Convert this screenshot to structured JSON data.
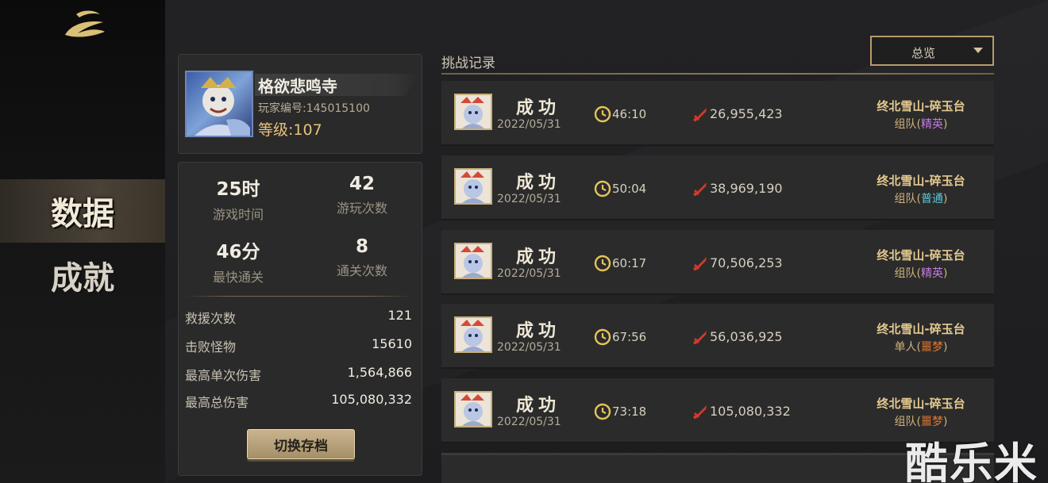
{
  "nav": {
    "data_label": "数据",
    "achievement_label": "成就"
  },
  "profile": {
    "name": "格欲悲鸣寺",
    "player_id": "玩家编号:145015100",
    "level": "等级:107"
  },
  "stats": {
    "play_time_value": "25时",
    "play_time_label": "游戏时间",
    "play_count_value": "42",
    "play_count_label": "游玩次数",
    "fastest_value": "46分",
    "fastest_label": "最快通关",
    "clear_count_value": "8",
    "clear_count_label": "通关次数",
    "rows": [
      {
        "label": "救援次数",
        "value": "121"
      },
      {
        "label": "击败怪物",
        "value": "15610"
      },
      {
        "label": "最高单次伤害",
        "value": "1,564,866"
      },
      {
        "label": "最高总伤害",
        "value": "105,080,332"
      }
    ],
    "switch_save_label": "切换存档"
  },
  "records_header": {
    "title": "挑战记录",
    "filter_value": "总览"
  },
  "records": [
    {
      "result": "成功",
      "date": "2022/05/31",
      "time": "46:10",
      "damage": "26,955,423",
      "stage": "终北雪山-碎玉台",
      "mode_prefix": "组队(",
      "difficulty": "精英",
      "mode_suffix": ")"
    },
    {
      "result": "成功",
      "date": "2022/05/31",
      "time": "50:04",
      "damage": "38,969,190",
      "stage": "终北雪山-碎玉台",
      "mode_prefix": "组队(",
      "difficulty": "普通",
      "mode_suffix": ")"
    },
    {
      "result": "成功",
      "date": "2022/05/31",
      "time": "60:17",
      "damage": "70,506,253",
      "stage": "终北雪山-碎玉台",
      "mode_prefix": "组队(",
      "difficulty": "精英",
      "mode_suffix": ")"
    },
    {
      "result": "成功",
      "date": "2022/05/31",
      "time": "67:56",
      "damage": "56,036,925",
      "stage": "终北雪山-碎玉台",
      "mode_prefix": "单人(",
      "difficulty": "噩梦",
      "mode_suffix": ")"
    },
    {
      "result": "成功",
      "date": "2022/05/31",
      "time": "73:18",
      "damage": "105,080,332",
      "stage": "终北雪山-碎玉台",
      "mode_prefix": "组队(",
      "difficulty": "噩梦",
      "mode_suffix": ")"
    }
  ],
  "colors": {
    "elite": "#c77ae4",
    "normal": "#5ec7d7",
    "nightmare": "#e2772f",
    "gold_accent": "#e4c98f"
  },
  "icons": {
    "logo": "brand-swoosh-icon",
    "clock": "clock-icon",
    "damage": "sword-icon",
    "dropdown": "chevron-down-icon"
  },
  "watermark": "酷乐米"
}
